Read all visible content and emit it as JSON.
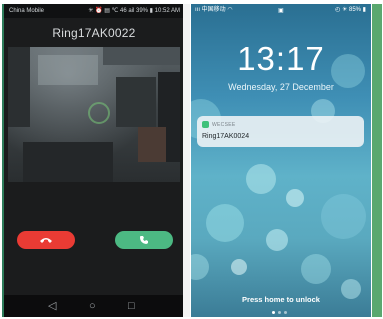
{
  "android": {
    "status_bar": {
      "carrier": "China Mobile",
      "indicators": "✳ ⏰ ▤ ℃ 46 ail 39% ▮",
      "time": "10:52 AM"
    },
    "caller_name": "Ring17AK0022",
    "buttons": {
      "decline_icon": "phone-hangup-icon",
      "accept_icon": "phone-icon",
      "decline_color": "#ea3b34",
      "accept_color": "#4cb983"
    },
    "nav": {
      "back": "◁",
      "home": "○",
      "recents": "□"
    }
  },
  "iphone": {
    "status_bar": {
      "carrier": "ııı 中国移动 ◠",
      "lock": "▣",
      "battery": "◴ ☀ 85% ▮"
    },
    "time": "13:17",
    "date": "Wednesday, 27 December",
    "notification": {
      "app_name": "WECSEE",
      "message": "Ring17AK0024"
    },
    "unlock_hint": "Press home to unlock"
  }
}
